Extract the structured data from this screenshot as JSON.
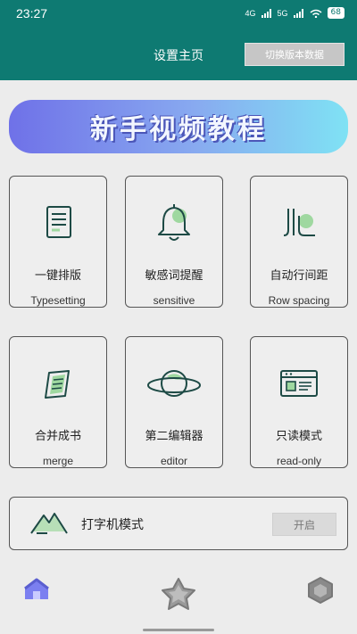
{
  "status": {
    "time": "23:27",
    "signal1": "4G",
    "signal2": "5G",
    "battery": "68"
  },
  "header": {
    "title": "设置主页",
    "switch_button": "切换版本数据"
  },
  "banner": {
    "text": "新手视频教程"
  },
  "features": [
    {
      "label_cn": "一键排版",
      "label_en": "Typesetting",
      "icon": "document-icon"
    },
    {
      "label_cn": "敏感词提醒",
      "label_en": "sensitive",
      "icon": "bell-icon"
    },
    {
      "label_cn": "自动行间距",
      "label_en": "Row spacing",
      "icon": "row-spacing-icon"
    },
    {
      "label_cn": "合并成书",
      "label_en": "merge",
      "icon": "book-icon"
    },
    {
      "label_cn": "第二编辑器",
      "label_en": "editor",
      "icon": "planet-icon"
    },
    {
      "label_cn": "只读模式",
      "label_en": "read-only",
      "icon": "browser-window-icon"
    }
  ],
  "typewriter": {
    "label": "打字机模式",
    "button": "开启",
    "icon": "mountain-icon"
  },
  "nav": {
    "items": [
      "home-icon",
      "star-icon",
      "settings-hex-icon"
    ]
  },
  "colors": {
    "header_bg": "#0e7a72",
    "accent_green": "#9fd8a0",
    "icon_dark": "#1d4a45"
  }
}
